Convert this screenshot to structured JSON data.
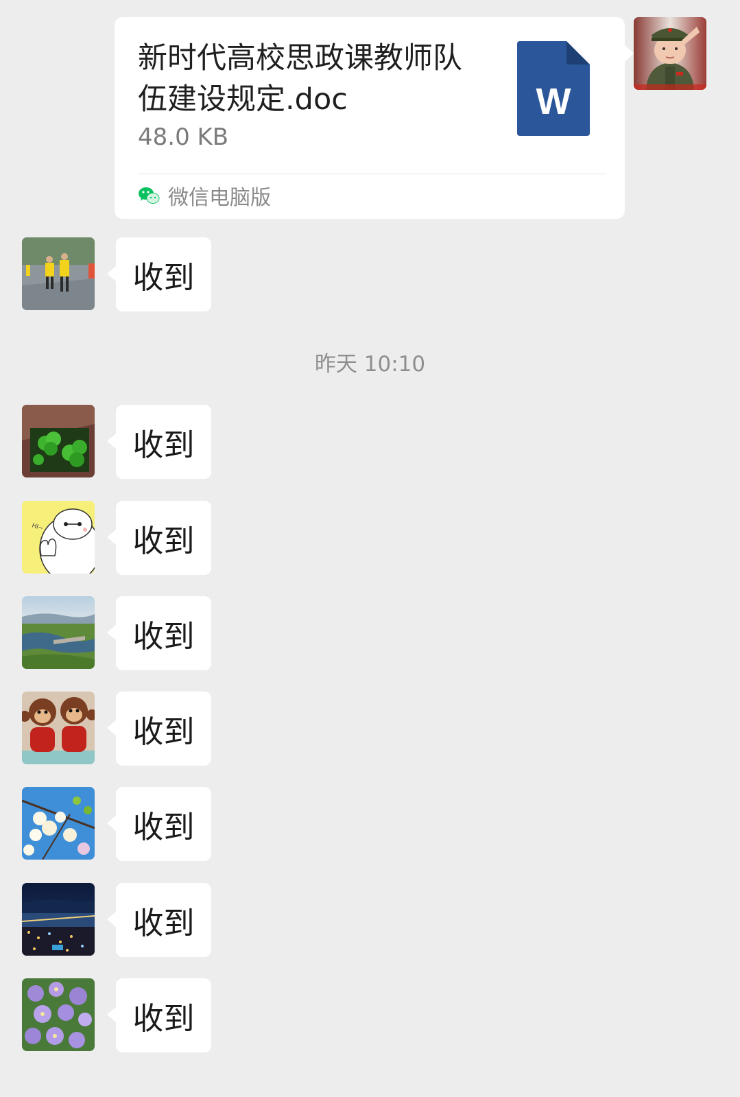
{
  "file_message": {
    "file_name": "新时代高校思政课教师队伍建设规定.doc",
    "file_size": "48.0 KB",
    "file_type_letter": "W",
    "source_label": "微信电脑版",
    "colors": {
      "word_blue": "#2b579a",
      "wechat_green": "#07c160"
    }
  },
  "timestamp": "昨天 10:10",
  "messages": [
    {
      "text": "收到",
      "avatar": "runners-in-rain-photo"
    },
    {
      "text": "收到",
      "avatar": "clover-leaves-photo"
    },
    {
      "text": "收到",
      "avatar": "baymax-cartoon"
    },
    {
      "text": "收到",
      "avatar": "river-bridge-landscape"
    },
    {
      "text": "收到",
      "avatar": "plush-monkeys-photo"
    },
    {
      "text": "收到",
      "avatar": "white-blossoms-blue-sky"
    },
    {
      "text": "收到",
      "avatar": "night-city-bridge"
    },
    {
      "text": "收到",
      "avatar": "purple-flowers-photo"
    }
  ],
  "avatar_hi_text": "HI~"
}
